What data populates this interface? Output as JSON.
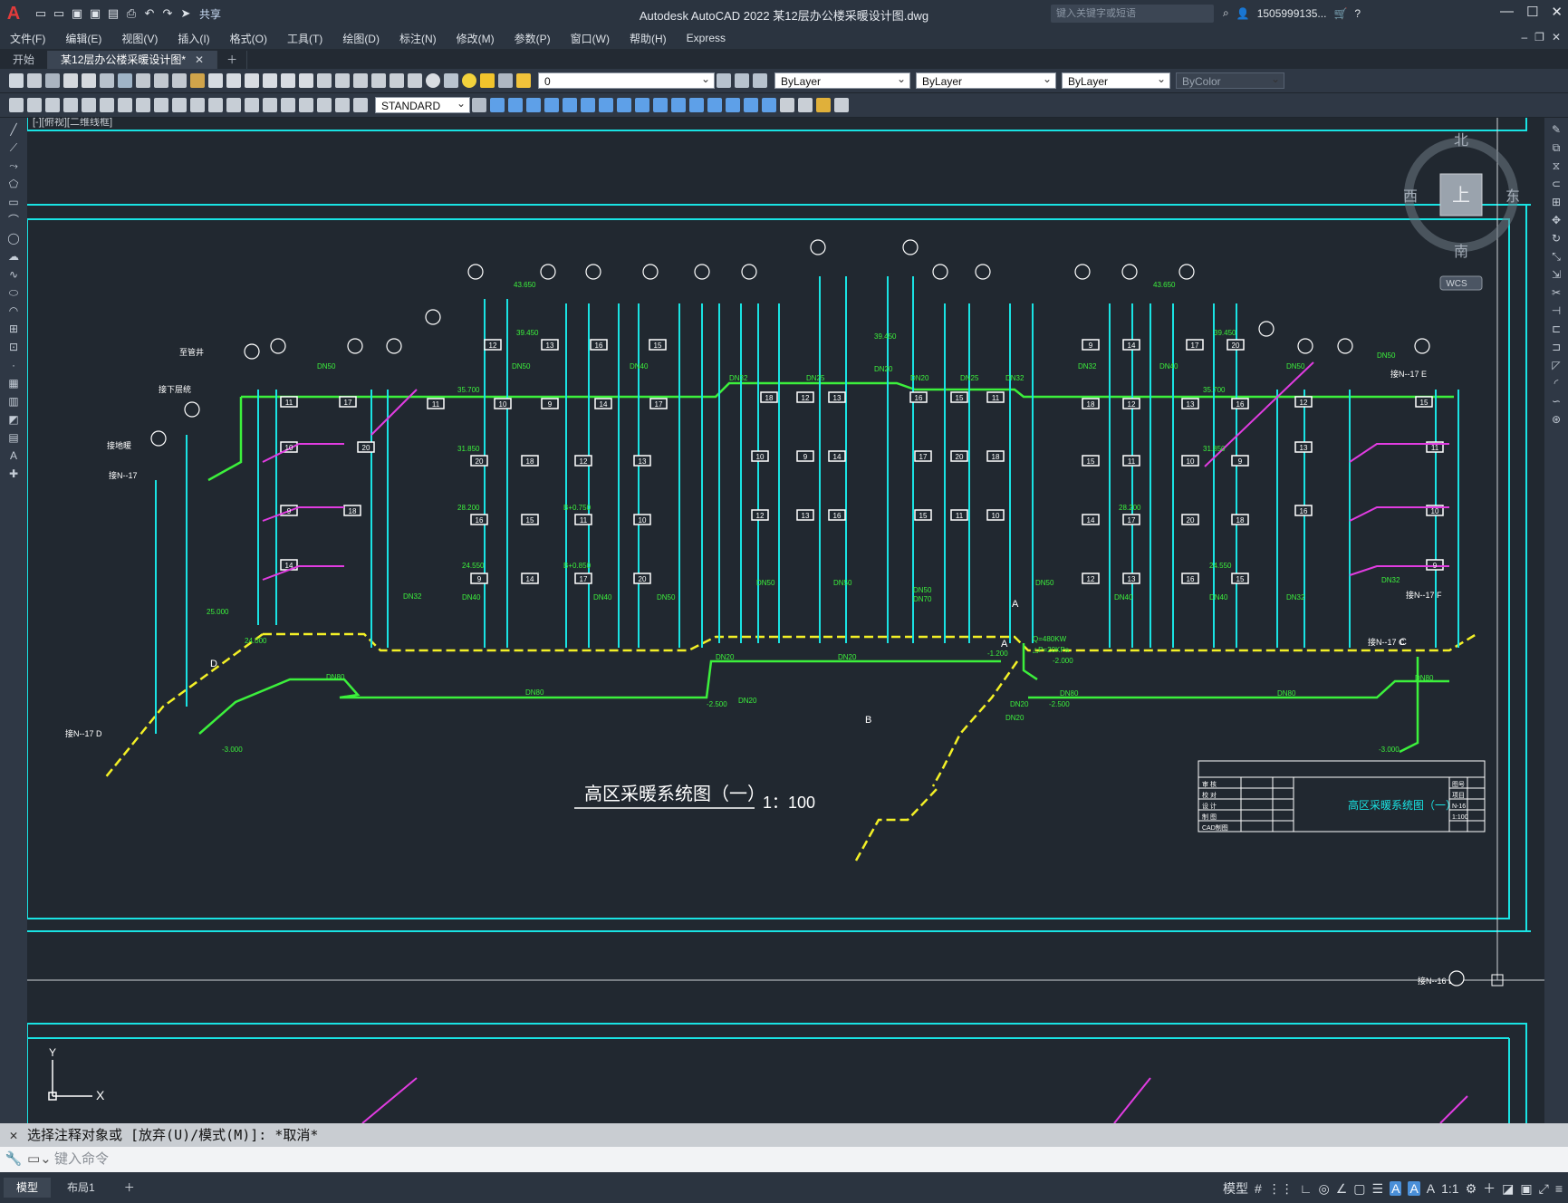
{
  "app": {
    "title": "Autodesk AutoCAD 2022    某12层办公楼采暖设计图.dwg",
    "share": "共享",
    "search_placeholder": "键入关键字或短语",
    "user": "1505999135..."
  },
  "menu": [
    "文件(F)",
    "编辑(E)",
    "视图(V)",
    "插入(I)",
    "格式(O)",
    "工具(T)",
    "绘图(D)",
    "标注(N)",
    "修改(M)",
    "参数(P)",
    "窗口(W)",
    "帮助(H)",
    "Express"
  ],
  "tabs": [
    {
      "label": "开始"
    },
    {
      "label": "某12层办公楼采暖设计图*"
    }
  ],
  "toolbar": {
    "layer": "0",
    "color": "ByLayer",
    "linetype": "ByLayer",
    "lineweight": "ByLayer",
    "plotstyle": "ByColor",
    "textstyle": "STANDARD"
  },
  "viewport": {
    "label": "[-][俯视][二维线框]"
  },
  "viewcube": {
    "north": "北",
    "south": "南",
    "east": "东",
    "west": "西",
    "top": "上",
    "wcs": "WCS"
  },
  "drawing": {
    "title": "高区采暖系统图（一）",
    "scale": "1：100",
    "titleblock": {
      "name": "高区采暖系统图（一）",
      "rows": [
        "审 核",
        "校 对",
        "设 计",
        "制 图",
        "CAD制图"
      ],
      "right": [
        "图号",
        "项目",
        "N-16",
        "1:100"
      ]
    },
    "labels": [
      "DN50",
      "DN40",
      "DN32",
      "DN25",
      "DN20",
      "DN70",
      "DN80",
      "43.650",
      "39.450",
      "35.700",
      "31.850",
      "28.200",
      "24.550",
      "B+0.750",
      "B+0.850",
      "25.000",
      "24.000",
      "-3.000",
      "-2.500",
      "-1.200",
      "-2.000",
      "Q=480KW",
      "△P=20KPa",
      "接N--17",
      "接N--17 E",
      "接N--17 F",
      "接N--17 C",
      "接N--17 D",
      "接N--16 E",
      "接地暖",
      "接下层统",
      "A",
      "B",
      "C",
      "D",
      "E",
      "F",
      "至管井"
    ],
    "radiator_counts": [
      "12",
      "13",
      "16",
      "15",
      "11",
      "10",
      "9",
      "14",
      "17",
      "20",
      "18"
    ]
  },
  "command": {
    "history": "选择注释对象或 [放弃(U)/模式(M)]: *取消*",
    "prompt": "键入命令"
  },
  "status": {
    "model": "模型",
    "layout": "布局1",
    "scale": "1:1",
    "model_btn": "模型"
  }
}
